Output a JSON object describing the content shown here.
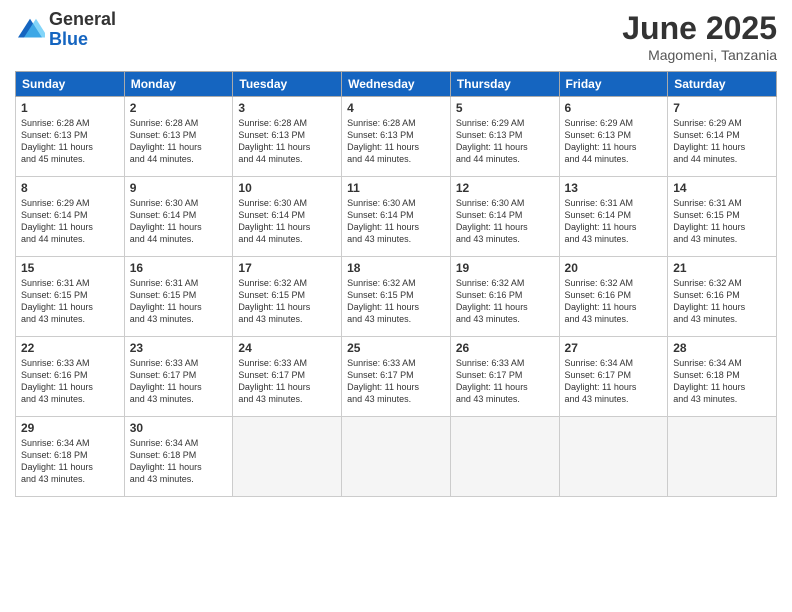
{
  "logo": {
    "general": "General",
    "blue": "Blue"
  },
  "title": "June 2025",
  "location": "Magomeni, Tanzania",
  "days_of_week": [
    "Sunday",
    "Monday",
    "Tuesday",
    "Wednesday",
    "Thursday",
    "Friday",
    "Saturday"
  ],
  "weeks": [
    [
      {
        "day": "1",
        "sunrise": "6:28 AM",
        "sunset": "6:13 PM",
        "daylight": "11 hours and 45 minutes."
      },
      {
        "day": "2",
        "sunrise": "6:28 AM",
        "sunset": "6:13 PM",
        "daylight": "11 hours and 44 minutes."
      },
      {
        "day": "3",
        "sunrise": "6:28 AM",
        "sunset": "6:13 PM",
        "daylight": "11 hours and 44 minutes."
      },
      {
        "day": "4",
        "sunrise": "6:28 AM",
        "sunset": "6:13 PM",
        "daylight": "11 hours and 44 minutes."
      },
      {
        "day": "5",
        "sunrise": "6:29 AM",
        "sunset": "6:13 PM",
        "daylight": "11 hours and 44 minutes."
      },
      {
        "day": "6",
        "sunrise": "6:29 AM",
        "sunset": "6:13 PM",
        "daylight": "11 hours and 44 minutes."
      },
      {
        "day": "7",
        "sunrise": "6:29 AM",
        "sunset": "6:14 PM",
        "daylight": "11 hours and 44 minutes."
      }
    ],
    [
      {
        "day": "8",
        "sunrise": "6:29 AM",
        "sunset": "6:14 PM",
        "daylight": "11 hours and 44 minutes."
      },
      {
        "day": "9",
        "sunrise": "6:30 AM",
        "sunset": "6:14 PM",
        "daylight": "11 hours and 44 minutes."
      },
      {
        "day": "10",
        "sunrise": "6:30 AM",
        "sunset": "6:14 PM",
        "daylight": "11 hours and 44 minutes."
      },
      {
        "day": "11",
        "sunrise": "6:30 AM",
        "sunset": "6:14 PM",
        "daylight": "11 hours and 43 minutes."
      },
      {
        "day": "12",
        "sunrise": "6:30 AM",
        "sunset": "6:14 PM",
        "daylight": "11 hours and 43 minutes."
      },
      {
        "day": "13",
        "sunrise": "6:31 AM",
        "sunset": "6:14 PM",
        "daylight": "11 hours and 43 minutes."
      },
      {
        "day": "14",
        "sunrise": "6:31 AM",
        "sunset": "6:15 PM",
        "daylight": "11 hours and 43 minutes."
      }
    ],
    [
      {
        "day": "15",
        "sunrise": "6:31 AM",
        "sunset": "6:15 PM",
        "daylight": "11 hours and 43 minutes."
      },
      {
        "day": "16",
        "sunrise": "6:31 AM",
        "sunset": "6:15 PM",
        "daylight": "11 hours and 43 minutes."
      },
      {
        "day": "17",
        "sunrise": "6:32 AM",
        "sunset": "6:15 PM",
        "daylight": "11 hours and 43 minutes."
      },
      {
        "day": "18",
        "sunrise": "6:32 AM",
        "sunset": "6:15 PM",
        "daylight": "11 hours and 43 minutes."
      },
      {
        "day": "19",
        "sunrise": "6:32 AM",
        "sunset": "6:16 PM",
        "daylight": "11 hours and 43 minutes."
      },
      {
        "day": "20",
        "sunrise": "6:32 AM",
        "sunset": "6:16 PM",
        "daylight": "11 hours and 43 minutes."
      },
      {
        "day": "21",
        "sunrise": "6:32 AM",
        "sunset": "6:16 PM",
        "daylight": "11 hours and 43 minutes."
      }
    ],
    [
      {
        "day": "22",
        "sunrise": "6:33 AM",
        "sunset": "6:16 PM",
        "daylight": "11 hours and 43 minutes."
      },
      {
        "day": "23",
        "sunrise": "6:33 AM",
        "sunset": "6:17 PM",
        "daylight": "11 hours and 43 minutes."
      },
      {
        "day": "24",
        "sunrise": "6:33 AM",
        "sunset": "6:17 PM",
        "daylight": "11 hours and 43 minutes."
      },
      {
        "day": "25",
        "sunrise": "6:33 AM",
        "sunset": "6:17 PM",
        "daylight": "11 hours and 43 minutes."
      },
      {
        "day": "26",
        "sunrise": "6:33 AM",
        "sunset": "6:17 PM",
        "daylight": "11 hours and 43 minutes."
      },
      {
        "day": "27",
        "sunrise": "6:34 AM",
        "sunset": "6:17 PM",
        "daylight": "11 hours and 43 minutes."
      },
      {
        "day": "28",
        "sunrise": "6:34 AM",
        "sunset": "6:18 PM",
        "daylight": "11 hours and 43 minutes."
      }
    ],
    [
      {
        "day": "29",
        "sunrise": "6:34 AM",
        "sunset": "6:18 PM",
        "daylight": "11 hours and 43 minutes."
      },
      {
        "day": "30",
        "sunrise": "6:34 AM",
        "sunset": "6:18 PM",
        "daylight": "11 hours and 43 minutes."
      },
      null,
      null,
      null,
      null,
      null
    ]
  ]
}
